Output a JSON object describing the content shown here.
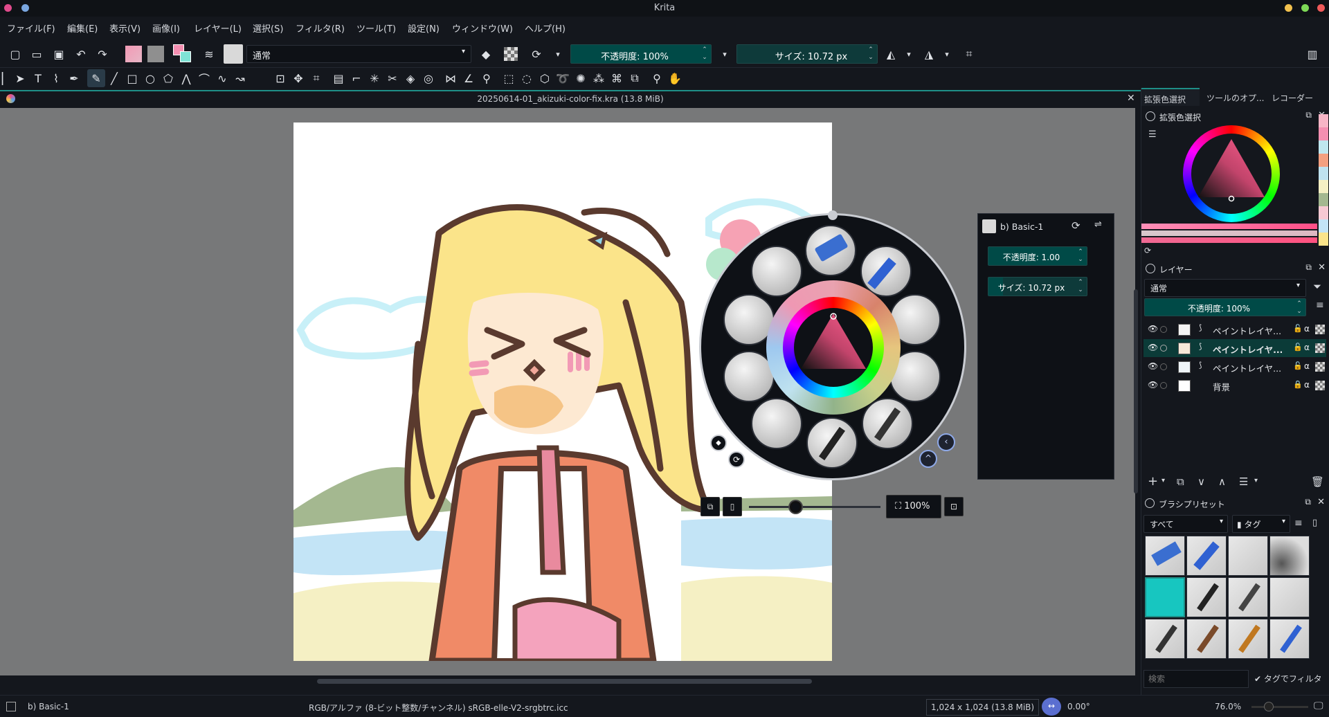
{
  "window": {
    "title": "Krita"
  },
  "menu": [
    "ファイル(F)",
    "編集(E)",
    "表示(V)",
    "画像(I)",
    "レイヤー(L)",
    "選択(S)",
    "フィルタ(R)",
    "ツール(T)",
    "設定(N)",
    "ウィンドウ(W)",
    "ヘルプ(H)"
  ],
  "toolbar": {
    "blend_mode": "通常",
    "opacity_label": "不透明度: 100%",
    "opacity_value": 1.0,
    "size_label": "サイズ: 10.72 px",
    "size_fill": 0.0
  },
  "document": {
    "tab_title": "20250614-01_akizuki-color-fix.kra (13.8 MiB)"
  },
  "brush_editor": {
    "preset_name": "b) Basic-1",
    "opacity_label": "不透明度: 1.00",
    "opacity_value": 1.0,
    "size_label": "サイズ: 10.72 px",
    "size_fill": 0.15
  },
  "canvas_zoom": {
    "label": "100%",
    "slider_position": 0.35
  },
  "dock": {
    "tabs": [
      "拡張色選択",
      "ツールのオプ...",
      "レコーダー"
    ],
    "color_selector": {
      "title": "拡張色選択"
    },
    "layers": {
      "title": "レイヤー",
      "blend_mode": "通常",
      "opacity_label": "不透明度: 100%",
      "items": [
        {
          "name": "ペイントレイヤ...",
          "active": false
        },
        {
          "name": "ペイントレイヤ...",
          "active": true
        },
        {
          "name": "ペイントレイヤ...",
          "active": false
        },
        {
          "name": "背景",
          "active": false
        }
      ]
    },
    "brush_presets": {
      "title": "ブラシプリセット",
      "filter": "すべて",
      "tag_label": "タグ",
      "search_placeholder": "検索",
      "filter_by_tag_label": "タグでフィルタ"
    }
  },
  "status": {
    "preset": "b) Basic-1",
    "color_space": "RGB/アルファ (8-ビット整数/チャンネル)  sRGB-elle-V2-srgbtrc.icc",
    "image_size": "1,024 x 1,024 (13.8 MiB)",
    "rotation": "0.00°",
    "zoom": "76.0%"
  },
  "colors": {
    "accent": "#1f8f88",
    "slider_fill": "#004a47",
    "canvas_bg": "#777879"
  }
}
